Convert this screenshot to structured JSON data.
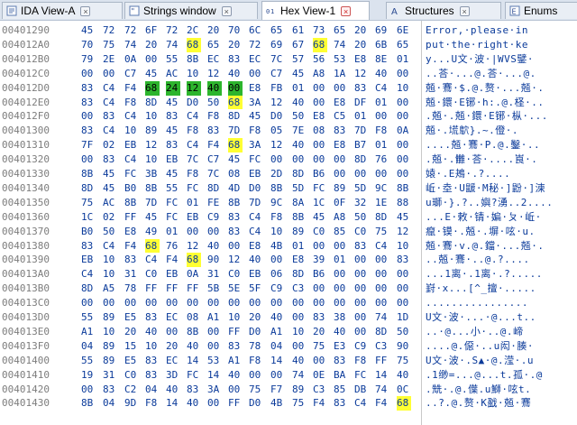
{
  "tabs": [
    {
      "label": "IDA View-A",
      "icon": "ida-view-icon",
      "active": false
    },
    {
      "label": "Strings window",
      "icon": "strings-icon",
      "active": false
    },
    {
      "label": "Hex View-1",
      "icon": "hex-view-icon",
      "active": true
    },
    {
      "label": "Structures",
      "icon": "structures-icon",
      "active": false
    },
    {
      "label": "Enums",
      "icon": "enums-icon",
      "active": false
    }
  ],
  "colors": {
    "highlight": "#ffff33",
    "cursor": "#2db52d",
    "hex_text": "#0a3a9a",
    "address": "#7d7d7d"
  },
  "rows": [
    {
      "addr": "00401290",
      "bytes": [
        "45",
        "72",
        "72",
        "6F",
        "72",
        "2C",
        "20",
        "70",
        "6C",
        "65",
        "61",
        "73",
        "65",
        "20",
        "69",
        "6E"
      ],
      "hl": [],
      "cur": [],
      "ascii": "Error,·please·in"
    },
    {
      "addr": "004012A0",
      "bytes": [
        "70",
        "75",
        "74",
        "20",
        "74",
        "68",
        "65",
        "20",
        "72",
        "69",
        "67",
        "68",
        "74",
        "20",
        "6B",
        "65"
      ],
      "hl": [
        5,
        11
      ],
      "cur": [],
      "ascii": "put·the·right·ke"
    },
    {
      "addr": "004012B0",
      "bytes": [
        "79",
        "2E",
        "0A",
        "00",
        "55",
        "8B",
        "EC",
        "83",
        "EC",
        "7C",
        "57",
        "56",
        "53",
        "E8",
        "8E",
        "01"
      ],
      "hl": [],
      "cur": [],
      "ascii": "y...U文·波·|WVS鐾·"
    },
    {
      "addr": "004012C0",
      "bytes": [
        "00",
        "00",
        "C7",
        "45",
        "AC",
        "10",
        "12",
        "40",
        "00",
        "C7",
        "45",
        "A8",
        "1A",
        "12",
        "40",
        "00"
      ],
      "hl": [],
      "cur": [],
      "ascii": "..荅·...@.荅·...@."
    },
    {
      "addr": "004012D0",
      "bytes": [
        "83",
        "C4",
        "F4",
        "68",
        "24",
        "12",
        "40",
        "00",
        "E8",
        "FB",
        "01",
        "00",
        "00",
        "83",
        "C4",
        "10"
      ],
      "hl": [],
      "cur": [
        3,
        4,
        5,
        6,
        7
      ],
      "ascii": "兡·鶱·$.@.赘·...兡·."
    },
    {
      "addr": "004012E0",
      "bytes": [
        "83",
        "C4",
        "F8",
        "8D",
        "45",
        "D0",
        "50",
        "68",
        "3A",
        "12",
        "40",
        "00",
        "E8",
        "DF",
        "01",
        "00"
      ],
      "hl": [
        7
      ],
      "cur": [],
      "ascii": "兡·鐶·E铘·h:.@.柽·.."
    },
    {
      "addr": "004012F0",
      "bytes": [
        "00",
        "83",
        "C4",
        "10",
        "83",
        "C4",
        "F8",
        "8D",
        "45",
        "D0",
        "50",
        "E8",
        "C5",
        "01",
        "00",
        "00"
      ],
      "hl": [],
      "cur": [],
      "ascii": ".兡·.兡·鐶·E铘·枞·..."
    },
    {
      "addr": "00401300",
      "bytes": [
        "83",
        "C4",
        "10",
        "89",
        "45",
        "F8",
        "83",
        "7D",
        "F8",
        "05",
        "7E",
        "08",
        "83",
        "7D",
        "F8",
        "0A"
      ],
      "hl": [],
      "cur": [],
      "ascii": "兡·.塃鴥}.~.僜·."
    },
    {
      "addr": "00401310",
      "bytes": [
        "7F",
        "02",
        "EB",
        "12",
        "83",
        "C4",
        "F4",
        "68",
        "3A",
        "12",
        "40",
        "00",
        "E8",
        "B7",
        "01",
        "00"
      ],
      "hl": [
        7
      ],
      "cur": [],
      "ascii": "....兡·鶱·P.@.鑿·.."
    },
    {
      "addr": "00401320",
      "bytes": [
        "00",
        "83",
        "C4",
        "10",
        "EB",
        "7C",
        "C7",
        "45",
        "FC",
        "00",
        "00",
        "00",
        "00",
        "8D",
        "76",
        "00"
      ],
      "hl": [],
      "cur": [],
      "ascii": ".兡·.雦·荅·....崀·."
    },
    {
      "addr": "00401330",
      "bytes": [
        "8B",
        "45",
        "FC",
        "3B",
        "45",
        "F8",
        "7C",
        "08",
        "EB",
        "2D",
        "8D",
        "B6",
        "00",
        "00",
        "00",
        "00"
      ],
      "hl": [],
      "cur": [],
      "ascii": "媴·.E鴂·.?...."
    },
    {
      "addr": "00401340",
      "bytes": [
        "8D",
        "45",
        "B0",
        "8B",
        "55",
        "FC",
        "8D",
        "4D",
        "D0",
        "8B",
        "5D",
        "FC",
        "89",
        "5D",
        "9C",
        "8B"
      ],
      "hl": [],
      "cur": [],
      "ascii": "岴·坴·U鼶·M秘·]鼢·]湅"
    },
    {
      "addr": "00401350",
      "bytes": [
        "75",
        "AC",
        "8B",
        "7D",
        "FC",
        "01",
        "FE",
        "8B",
        "7D",
        "9C",
        "8A",
        "1C",
        "0F",
        "32",
        "1E",
        "88"
      ],
      "hl": [],
      "cur": [],
      "ascii": "u瑡·}.?..嬩?湧..2...."
    },
    {
      "addr": "00401360",
      "bytes": [
        "1C",
        "02",
        "FF",
        "45",
        "FC",
        "EB",
        "C9",
        "83",
        "C4",
        "F8",
        "8B",
        "45",
        "A8",
        "50",
        "8D",
        "45"
      ],
      "hl": [],
      "cur": [],
      "ascii": "...E·敕·锖·媥·ㄆ·岴·"
    },
    {
      "addr": "00401370",
      "bytes": [
        "B0",
        "50",
        "E8",
        "49",
        "01",
        "00",
        "00",
        "83",
        "C4",
        "10",
        "89",
        "C0",
        "85",
        "C0",
        "75",
        "12"
      ],
      "hl": [],
      "cur": [],
      "ascii": "癙·镆·.兡·.塀·呟·u."
    },
    {
      "addr": "00401380",
      "bytes": [
        "83",
        "C4",
        "F4",
        "68",
        "76",
        "12",
        "40",
        "00",
        "E8",
        "4B",
        "01",
        "00",
        "00",
        "83",
        "C4",
        "10"
      ],
      "hl": [
        3
      ],
      "cur": [],
      "ascii": "兡·鶱·v.@.鐺·...兡·."
    },
    {
      "addr": "00401390",
      "bytes": [
        "EB",
        "10",
        "83",
        "C4",
        "F4",
        "68",
        "90",
        "12",
        "40",
        "00",
        "E8",
        "39",
        "01",
        "00",
        "00",
        "83"
      ],
      "hl": [
        5
      ],
      "cur": [],
      "ascii": "..兡·鶱·..@.?...."
    },
    {
      "addr": "004013A0",
      "cors": 0,
      "bytes": [
        "C4",
        "10",
        "31",
        "C0",
        "EB",
        "0A",
        "31",
        "C0",
        "EB",
        "06",
        "8D",
        "B6",
        "00",
        "00",
        "00",
        "00"
      ],
      "hl": [],
      "cur": [],
      "ascii": "...1离·.1离·.?....."
    },
    {
      "addr": "004013B0",
      "bytes": [
        "8D",
        "A5",
        "78",
        "FF",
        "FF",
        "FF",
        "5B",
        "5E",
        "5F",
        "C9",
        "C3",
        "00",
        "00",
        "00",
        "00",
        "00"
      ],
      "hl": [],
      "cur": [],
      "ascii": "崶·x...[^_擅·....."
    },
    {
      "addr": "004013C0",
      "bytes": [
        "00",
        "00",
        "00",
        "00",
        "00",
        "00",
        "00",
        "00",
        "00",
        "00",
        "00",
        "00",
        "00",
        "00",
        "00",
        "00"
      ],
      "hl": [],
      "cur": [],
      "ascii": "................"
    },
    {
      "addr": "004013D0",
      "bytes": [
        "55",
        "89",
        "E5",
        "83",
        "EC",
        "08",
        "A1",
        "10",
        "20",
        "40",
        "00",
        "83",
        "38",
        "00",
        "74",
        "1D"
      ],
      "hl": [],
      "cur": [],
      "ascii": "U文·波·...·@...t.."
    },
    {
      "addr": "004013E0",
      "bytes": [
        "A1",
        "10",
        "20",
        "40",
        "00",
        "8B",
        "00",
        "FF",
        "D0",
        "A1",
        "10",
        "20",
        "40",
        "00",
        "8D",
        "50"
      ],
      "hl": [],
      "cur": [],
      "ascii": "..·@...小·..@.崹"
    },
    {
      "addr": "004013F0",
      "bytes": [
        "04",
        "89",
        "15",
        "10",
        "20",
        "40",
        "00",
        "83",
        "78",
        "04",
        "00",
        "75",
        "E3",
        "C9",
        "C3",
        "90"
      ],
      "hl": [],
      "cur": [],
      "ascii": "....@.僫·..u闳·腠·"
    },
    {
      "addr": "00401400",
      "bytes": [
        "55",
        "89",
        "E5",
        "83",
        "EC",
        "14",
        "53",
        "A1",
        "F8",
        "14",
        "40",
        "00",
        "83",
        "F8",
        "FF",
        "75"
      ],
      "hl": [],
      "cur": [],
      "ascii": "U文·波·.S▲·@.滢·.u"
    },
    {
      "addr": "00401410",
      "bytes": [
        "19",
        "31",
        "C0",
        "83",
        "3D",
        "FC",
        "14",
        "40",
        "00",
        "00",
        "74",
        "0E",
        "BA",
        "FC",
        "14",
        "40"
      ],
      "hl": [],
      "cur": [],
      "ascii": ".1缈=...@...t.孤·.@"
    },
    {
      "addr": "00401420",
      "bytes": [
        "00",
        "83",
        "C2",
        "04",
        "40",
        "83",
        "3A",
        "00",
        "75",
        "F7",
        "89",
        "C3",
        "85",
        "DB",
        "74",
        "0C"
      ],
      "hl": [],
      "cur": [],
      "ascii": ".兟·.@.僷.u鰤·呟t."
    },
    {
      "addr": "00401430",
      "bytes": [
        "8B",
        "04",
        "9D",
        "F8",
        "14",
        "40",
        "00",
        "FF",
        "D0",
        "4B",
        "75",
        "F4",
        "83",
        "C4",
        "F4",
        "68"
      ],
      "hl": [
        15
      ],
      "cur": [],
      "ascii": "..?.@.赘·K戤·兡·鶱"
    }
  ]
}
